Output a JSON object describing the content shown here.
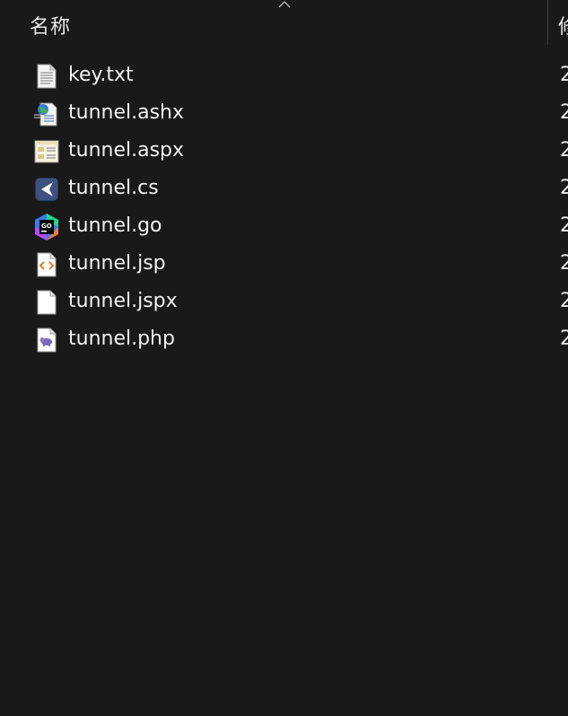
{
  "header": {
    "name_label": "名称",
    "next_label": "修改日期"
  },
  "files": [
    {
      "name": "key.txt",
      "icon": "text-file-icon",
      "date": "2"
    },
    {
      "name": "tunnel.ashx",
      "icon": "ashx-handler-file-icon",
      "date": "2"
    },
    {
      "name": "tunnel.aspx",
      "icon": "aspx-page-file-icon",
      "date": "2"
    },
    {
      "name": "tunnel.cs",
      "icon": "csharp-file-icon",
      "date": "2"
    },
    {
      "name": "tunnel.go",
      "icon": "goland-go-file-icon",
      "date": "2"
    },
    {
      "name": "tunnel.jsp",
      "icon": "jsp-file-icon",
      "date": "2"
    },
    {
      "name": "tunnel.jspx",
      "icon": "blank-file-icon",
      "date": "2"
    },
    {
      "name": "tunnel.php",
      "icon": "php-file-icon",
      "date": "2"
    }
  ],
  "colors": {
    "background": "#191919",
    "text": "#f2f2f2",
    "divider": "#3c3c3c"
  }
}
